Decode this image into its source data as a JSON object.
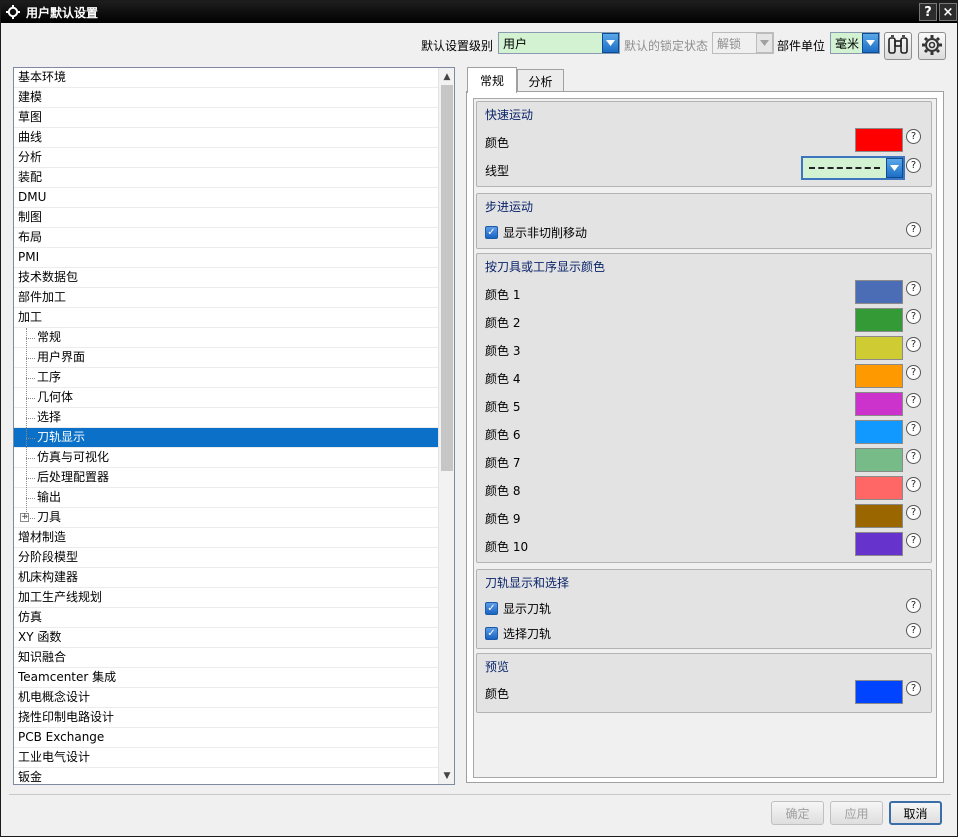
{
  "window": {
    "title": "用户默认设置",
    "help_label": "?",
    "close_label": "×"
  },
  "toolbar": {
    "level_label": "默认设置级别",
    "level_value": "用户",
    "lock_label": "默认的锁定状态",
    "lock_value": "解锁",
    "unit_label": "部件单位",
    "unit_value": "毫米"
  },
  "tree": {
    "top_items": [
      "基本环境",
      "建模",
      "草图",
      "曲线",
      "分析",
      "装配",
      "DMU",
      "制图",
      "布局",
      "PMI",
      "技术数据包",
      "部件加工",
      "加工"
    ],
    "machining_children": [
      "常规",
      "用户界面",
      "工序",
      "几何体",
      "选择",
      "刀轨显示",
      "仿真与可视化",
      "后处理配置器",
      "输出",
      "刀具"
    ],
    "selected": "刀轨显示",
    "bottom_items": [
      "增材制造",
      "分阶段模型",
      "机床构建器",
      "加工生产线规划",
      "仿真",
      "XY 函数",
      "知识融合",
      "Teamcenter 集成",
      "机电概念设计",
      "挠性印制电路设计",
      "PCB Exchange",
      "工业电气设计",
      "钣金"
    ]
  },
  "tabs": [
    {
      "label": "常规"
    },
    {
      "label": "分析"
    }
  ],
  "groups": {
    "rapid": {
      "title": "快速运动",
      "color_label": "颜色",
      "color": "#ff0000",
      "linetype_label": "线型"
    },
    "step": {
      "title": "步进运动",
      "checkbox_label": "显示非切削移动"
    },
    "tool_colors": {
      "title": "按刀具或工序显示颜色",
      "items": [
        {
          "label": "颜色 1",
          "color": "#4a6db5"
        },
        {
          "label": "颜色 2",
          "color": "#349a36"
        },
        {
          "label": "颜色 3",
          "color": "#cfcb33"
        },
        {
          "label": "颜色 4",
          "color": "#ff9900"
        },
        {
          "label": "颜色 5",
          "color": "#cc33cc"
        },
        {
          "label": "颜色 6",
          "color": "#1199ff"
        },
        {
          "label": "颜色 7",
          "color": "#77bb88"
        },
        {
          "label": "颜色 8",
          "color": "#ff6666"
        },
        {
          "label": "颜色 9",
          "color": "#996600"
        },
        {
          "label": "颜色 10",
          "color": "#6633cc"
        }
      ]
    },
    "path_display": {
      "title": "刀轨显示和选择",
      "show_label": "显示刀轨",
      "select_label": "选择刀轨"
    },
    "preview": {
      "title": "预览",
      "color_label": "颜色",
      "color": "#0044ff"
    }
  },
  "buttons": {
    "ok": "确定",
    "apply": "应用",
    "cancel": "取消"
  }
}
